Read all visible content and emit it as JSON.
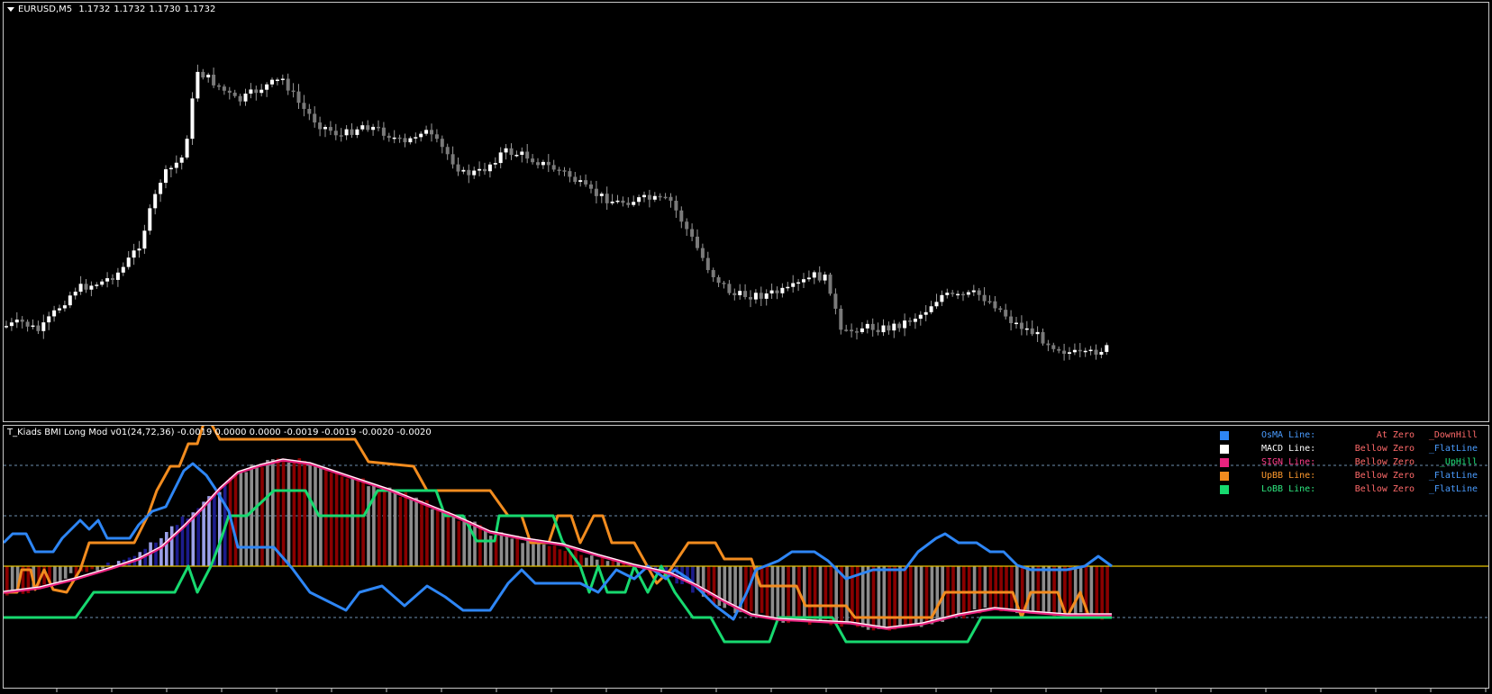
{
  "main_chart": {
    "symbol_header": "EURUSD,M5",
    "ohlc": [
      "1.1732",
      "1.1732",
      "1.1730",
      "1.1732"
    ]
  },
  "indicator": {
    "header": "T_Kiads BMI Long Mod v01(24,72,36) -0.0019 0.0000 0.0000 -0.0019 -0.0019 -0.0020 -0.0020",
    "legend": [
      {
        "label": "OsMA Line:",
        "state": "At Zero",
        "trend": "_DownHill",
        "color": "#2e86f5",
        "label_color": "#4a9cff",
        "trend_color": "#ff6a6a"
      },
      {
        "label": "MACD Line:",
        "state": "Bellow Zero",
        "trend": "_FlatLine",
        "color": "#ffffff",
        "label_color": "#ffffff",
        "trend_color": "#4a9cff"
      },
      {
        "label": "SIGN Line:",
        "state": "Bellow Zero",
        "trend": "_UpHill",
        "color": "#e8237f",
        "label_color": "#ff3d8b",
        "trend_color": "#1fe07a"
      },
      {
        "label": "UpBB Line:",
        "state": "Bellow Zero",
        "trend": "_FlatLine",
        "color": "#f28c1f",
        "label_color": "#ff9a2e",
        "trend_color": "#4a9cff"
      },
      {
        "label": "LoBB Line:",
        "state": "Bellow Zero",
        "trend": "_FlatLine",
        "color": "#17d96f",
        "label_color": "#2ee67f",
        "trend_color": "#4a9cff"
      }
    ],
    "state_color": "#ff6a6a",
    "colors": {
      "osma": "#2e86f5",
      "macd": "#ffffff",
      "signal": "#e8237f",
      "upper_band": "#f28c1f",
      "lower_band": "#17d96f",
      "zero_line": "#e6c200",
      "hist_up": "#8a0000",
      "hist_down": "#8c8c8c",
      "hist_neg": "#1c1c8c",
      "level_line": "#6e8fb0"
    }
  }
}
